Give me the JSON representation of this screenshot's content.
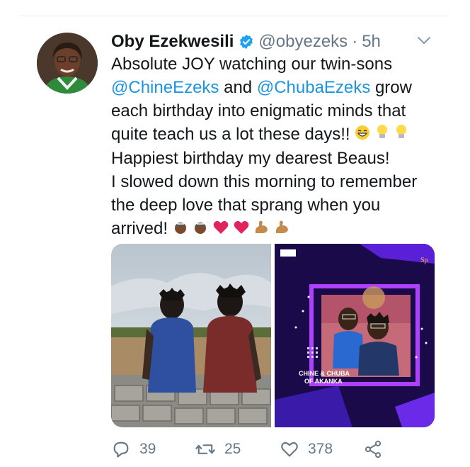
{
  "tweet": {
    "author_name": "Oby Ezekwesili",
    "handle": "@obyezeks",
    "separator": "·",
    "time": "5h",
    "lines": {
      "l1": "Absolute JOY watching our twin-sons",
      "mention1": "@ChineEzeks",
      "and": " and ",
      "mention2": "@ChubaEzeks",
      "grow": " grow",
      "l3": "each birthday into enigmatic minds that",
      "l4": "quite teach us a lot these days!!",
      "l5": "Happiest birthday my dearest Beaus!",
      "l6": "I slowed down this morning to remember",
      "l7": "the deep love that sprang when you",
      "l8": "arrived!"
    },
    "media_caption": {
      "line1": "CHINE & CHUBA",
      "line2": "OF AKANKA"
    }
  },
  "actions": {
    "replies": "39",
    "retweets": "25",
    "likes": "378"
  },
  "colors": {
    "link": "#1b95e0",
    "muted": "#657786",
    "verified": "#1da1f2"
  }
}
